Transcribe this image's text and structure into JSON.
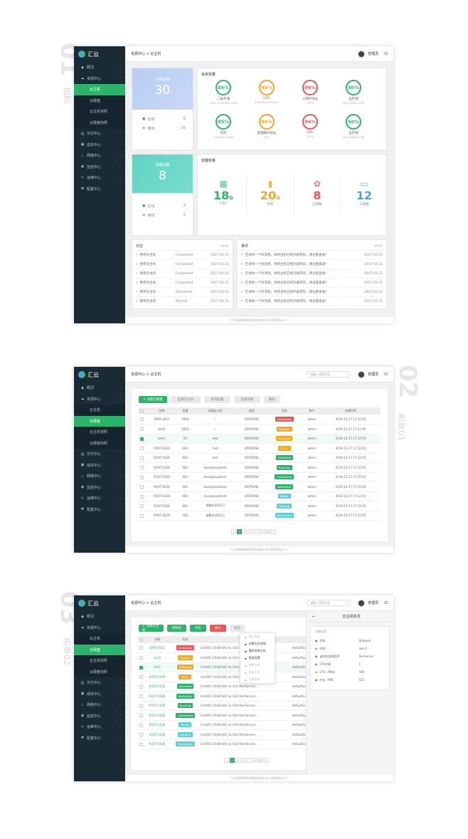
{
  "labels": {
    "s1_num": "01",
    "s1_txt": "首页",
    "s2_num": "02",
    "s2_txt": "表单01",
    "s3_num": "03",
    "s3_txt": "表单02"
  },
  "app": {
    "brand": "汇云",
    "user": "管理员",
    "footer": "广东昂璃网络科技股份有限公司©版权所有2017"
  },
  "sidebar": {
    "items": [
      {
        "label": "概况",
        "icon": "dashboard-icon",
        "key": "overview"
      },
      {
        "label": "资源中心",
        "icon": "cloud-icon",
        "key": "resource"
      },
      {
        "label": "云主机",
        "sub": true,
        "key": "vm"
      },
      {
        "label": "云硬盘",
        "sub": true,
        "key": "disk"
      },
      {
        "label": "云主机快照",
        "sub": true,
        "key": "vmsnap"
      },
      {
        "label": "云硬盘快照",
        "sub": true,
        "key": "disksnap"
      },
      {
        "label": "交付中心",
        "icon": "delivery-icon",
        "key": "delivery"
      },
      {
        "label": "成本中心",
        "icon": "cost-icon",
        "key": "cost"
      },
      {
        "label": "网络中心",
        "icon": "network-icon",
        "key": "network"
      },
      {
        "label": "监控中心",
        "icon": "monitor-icon",
        "key": "monitor"
      },
      {
        "label": "运维中心",
        "icon": "wrench-icon",
        "key": "ops"
      },
      {
        "label": "配置中心",
        "icon": "config-icon",
        "key": "config"
      }
    ]
  },
  "s1": {
    "crumb": "资源中心 > 云主机",
    "vm_card": {
      "title": "主机总数",
      "value": "30",
      "online_label": "在线",
      "online": "5",
      "offline_label": "离线",
      "offline": "25"
    },
    "ct_card": {
      "title": "容器总数",
      "value": "8",
      "online_label": "在线",
      "online": "3",
      "offline_label": "离线",
      "offline": "5"
    },
    "sys_title": "系统容量",
    "gauges": [
      {
        "pct": "85%",
        "name": "二级存储",
        "sub": "1301.47GB/462.00GB",
        "color": "#2bb56b"
      },
      {
        "pct": "95%",
        "name": "CPU",
        "sub": "9.99GHz/16.99GHz",
        "color": "#f5a623"
      },
      {
        "pct": "96%",
        "name": "公用IP地址",
        "sub": "15/15",
        "color": "#f25555"
      },
      {
        "pct": "50%",
        "name": "主存储",
        "sub": "795.47GB/1.01TB",
        "color": "#2bb56b"
      },
      {
        "pct": "85%",
        "name": "内存",
        "sub": "7.25GB/25.78GB",
        "color": "#2bb56b"
      },
      {
        "pct": "95%",
        "name": "管理网IP地址",
        "sub": "5/21",
        "color": "#f5a623"
      },
      {
        "pct": "96%",
        "name": "GPU",
        "sub": "15/15",
        "color": "#f25555"
      },
      {
        "pct": "50%",
        "name": "主存储",
        "sub": "795.47GB/1.01TB",
        "color": "#2bb56b"
      }
    ],
    "ct_title": "容器容量",
    "ct_stats": [
      {
        "value": "18",
        "unit": "G",
        "label": "CPU",
        "color": "#2bb56b",
        "icon": "cpu-icon"
      },
      {
        "value": "20",
        "unit": "G",
        "label": "内存",
        "color": "#f5a623",
        "icon": "memory-icon"
      },
      {
        "value": "8",
        "unit": "",
        "label": "应用数",
        "color": "#f25555",
        "icon": "apps-icon"
      },
      {
        "value": "12",
        "unit": "",
        "label": "工程数",
        "color": "#4aa5e0",
        "icon": "folder-icon"
      }
    ],
    "log": {
      "title": "日志",
      "more": "MORE",
      "rows": [
        {
          "a": "暂停云主机",
          "s": "Completed",
          "d": "2017-02-21"
        },
        {
          "a": "暂停云主机",
          "s": "Completed",
          "d": "2017-02-21"
        },
        {
          "a": "暂停云主机",
          "s": "Completed",
          "d": "2017-02-21"
        },
        {
          "a": "暂停云主机",
          "s": "Completed",
          "d": "2017-02-21"
        },
        {
          "a": "暂停云主机",
          "s": "Scheduled",
          "d": "2017-02-21"
        },
        {
          "a": "暂停云主机",
          "s": "Started",
          "d": "2017-02-21"
        }
      ]
    },
    "events": {
      "title": "事件",
      "more": "MORE",
      "rows": [
        {
          "t": "告诉你一个好消息，你的主机已经升级完毕，请注意查收！",
          "d": "2017-02-21"
        },
        {
          "t": "告诉你一个好消息，你的主机已经升级完毕，请注意查收！",
          "d": "2017-02-21"
        },
        {
          "t": "告诉你一个好消息，你的主机已经升级完毕，请注意查收！",
          "d": "2017-02-21"
        },
        {
          "t": "告诉你一个好消息，你的主机已经升级完毕，请注意查收！",
          "d": "2017-02-21"
        },
        {
          "t": "告诉你一个好消息，你的主机已经升级完毕，请注意查收！",
          "d": "2017-02-21"
        },
        {
          "t": "告诉你一个好消息，你的主机已经升级完毕，请注意查收！",
          "d": "2017-02-21"
        }
      ]
    }
  },
  "s2": {
    "crumb": "资源中心 > 云主机",
    "search_placeholder": "请输入搜索内容",
    "buttons": [
      "+ 创建云硬盘",
      "挂载云主机",
      "取消挂载",
      "创建快照",
      "删除"
    ],
    "headers": [
      "名称",
      "容量",
      "挂载云主机",
      "类型",
      "状态",
      "帐户",
      "创建时间"
    ],
    "rows": [
      {
        "c": false,
        "n": "DATA-2651",
        "cap": "500G",
        "h": "--",
        "t": "DATADISK",
        "s": "Destroyed",
        "sc": "#f25555",
        "a": "admin",
        "d": "2016-12-27 17:12:05"
      },
      {
        "c": false,
        "n": "test2",
        "cap": "500G",
        "h": "--",
        "t": "DATADISK",
        "s": "Stopped",
        "sc": "#f5a623",
        "a": "admin",
        "d": "2016-12-27 17:12:05"
      },
      {
        "c": true,
        "n": "test1",
        "cap": "5G",
        "h": "test",
        "t": "DATADISK",
        "s": "Stopping",
        "sc": "#f5a623",
        "a": "admin",
        "d": "2016-12-27 17:12:05"
      },
      {
        "c": false,
        "n": "ROOT-2628",
        "cap": "60G",
        "h": "test",
        "t": "DATADISK",
        "s": "Error",
        "sc": "#f5a623",
        "a": "admin",
        "d": "2016-12-27 17:12:05"
      },
      {
        "c": false,
        "n": "ROOT-2628",
        "cap": "60G",
        "h": "test",
        "t": "DATADISK",
        "s": "Allocated",
        "sc": "#2bb56b",
        "a": "admin",
        "d": "2016-12-27 17:12:05"
      },
      {
        "c": false,
        "n": "ROOT-2628",
        "cap": "60G",
        "h": "basegroupitests",
        "t": "DATADISK",
        "s": "Running",
        "sc": "#2bb56b",
        "a": "admin",
        "d": "2016-12-27 17:12:05"
      },
      {
        "c": false,
        "n": "ROOT-2628",
        "cap": "60G",
        "h": "basegroupitests",
        "t": "DATADISK",
        "s": "Completed",
        "sc": "#2bb56b",
        "a": "admin",
        "d": "2016-12-27 17:12:05"
      },
      {
        "c": false,
        "n": "ROOT-2628",
        "cap": "60G",
        "h": "basegroupitests",
        "t": "DATADISK",
        "s": "BackedUp",
        "sc": "#2bb56b",
        "a": "admin",
        "d": "2016-12-27 17:12:05"
      },
      {
        "c": false,
        "n": "ROOT-2628",
        "cap": "60G",
        "h": "basegroupitests",
        "t": "DATADISK",
        "s": "Ready",
        "sc": "#5bd0d8",
        "a": "admin",
        "d": "2016-12-27 17:12:05"
      },
      {
        "c": false,
        "n": "ROOT-2628",
        "cap": "60G",
        "h": "借聚技术2013",
        "t": "DATADISK",
        "s": "Starting",
        "sc": "#5bd0d8",
        "a": "admin",
        "d": "2016-12-27 17:12:05"
      },
      {
        "c": false,
        "n": "ROOT-2628",
        "cap": "40G",
        "h": "借聚技术2013",
        "t": "DATADISK",
        "s": "BackingUp",
        "sc": "#5bd0d8",
        "a": "admin",
        "d": "2016-12-27 17:12:05"
      }
    ],
    "pages": [
      "«",
      "1",
      "2",
      "3",
      "...",
      "9",
      "10",
      "»"
    ]
  },
  "s3": {
    "crumb": "资源中心 > 云主机",
    "search_placeholder": "请输入搜索内容",
    "buttons": [
      "+ 创建云主机",
      "控制台",
      "开启",
      "停止",
      "更多"
    ],
    "headers": [
      "名称",
      "状态",
      "镜像",
      "网络",
      ""
    ],
    "rows": [
      {
        "c": false,
        "n": "DATA-2651",
        "s": "Destroyed",
        "sc": "#f25555",
        "img": "CentOS 5.6(64-bit) no GUI (XenServer)...",
        "net": "defaultGuestNetwork...",
        "x": "10."
      },
      {
        "c": false,
        "n": "test2",
        "s": "Stopped",
        "sc": "#f5a623",
        "img": "CentOS 5.6(64-bit) no GUI (XenServer)...",
        "net": "defaultGuestNetwork...",
        "x": "10."
      },
      {
        "c": true,
        "n": "test1",
        "s": "Stopping",
        "sc": "#f5a623",
        "img": "CentOS 5.6(64-bit) no GUI (XenServer)...",
        "net": "defaultGuestNetwork...",
        "x": "10."
      },
      {
        "c": false,
        "n": "ROOT-2628",
        "s": "Error",
        "sc": "#f5a623",
        "img": "CentOS 5.6(64-bit) no GUI (XenServer)...",
        "net": "defaultGuestNetwork...",
        "x": "10."
      },
      {
        "c": false,
        "n": "ROOT-2628",
        "s": "Allocated",
        "sc": "#2bb56b",
        "img": "CentOS 5.6(64-bit) no GUI (XenServer)...",
        "net": "defaultGuestNetwork...",
        "x": "10."
      },
      {
        "c": false,
        "n": "ROOT-2628",
        "s": "BackedUp",
        "sc": "#2bb56b",
        "img": "CentOS 5.6(64-bit) no GUI (XenServer)...",
        "net": "defaultGuestNetwork...",
        "x": "10."
      },
      {
        "c": false,
        "n": "ROOT-2628",
        "s": "Running",
        "sc": "#2bb56b",
        "img": "CentOS 5.6(64-bit) no GUI (XenServer)...",
        "net": "defaultGuestNetwork...",
        "x": "10."
      },
      {
        "c": false,
        "n": "ROOT-2628",
        "s": "Completed",
        "sc": "#2bb56b",
        "img": "CentOS 5.6(64-bit) no GUI (XenServer)...",
        "net": "defaultGuestNetwork...",
        "x": "10."
      },
      {
        "c": false,
        "n": "ROOT-2628",
        "s": "Ready",
        "sc": "#5bd0d8",
        "img": "CentOS 5.6(64-bit) no GUI (XenServer)...",
        "net": "defaultGuestNetwork...",
        "x": "10."
      },
      {
        "c": false,
        "n": "ROOT-2628",
        "s": "Starting",
        "sc": "#5bd0d8",
        "img": "CentOS 5.6(64-bit) no GUI (XenServer)...",
        "net": "defaultGuestNetwork...",
        "x": "10."
      },
      {
        "c": false,
        "n": "ROOT-2628",
        "s": "BackingUp",
        "sc": "#5bd0d8",
        "img": "CentOS 5.6(64-bit) no GUI (XenServer)...",
        "net": "defaultGuestNetwork...",
        "x": "10."
      }
    ],
    "menu": [
      {
        "t": "重启主机",
        "dis": true
      },
      {
        "t": "创建主机快照",
        "dis": false
      },
      {
        "t": "重新安装主机",
        "dis": false
      },
      {
        "t": "更改设置",
        "dis": false
      },
      {
        "t": "删除主机",
        "dis": true
      },
      {
        "t": "恢复主机",
        "dis": true
      },
      {
        "t": "回收主机",
        "dis": true
      }
    ],
    "panel": {
      "back": "←",
      "title": "云主机状况",
      "section": "详细信息",
      "rows": [
        {
          "k": "状态",
          "v": "Stopped",
          "c": "#f25555"
        },
        {
          "k": "名称",
          "v": "aaa-1",
          "c": "#f5a623"
        },
        {
          "k": "虚拟机管理程序",
          "v": "XenServer",
          "c": "#2bb56b"
        },
        {
          "k": "CPU内核",
          "v": "1",
          "c": "#4aa5e0"
        },
        {
          "k": "CPU（MHz）",
          "v": "500",
          "c": "#f5a623"
        },
        {
          "k": "内存（MB）",
          "v": "512",
          "c": "#f25555"
        }
      ]
    },
    "pages": [
      "«",
      "1",
      "2",
      "3",
      "...",
      "9",
      "10",
      "»"
    ]
  }
}
